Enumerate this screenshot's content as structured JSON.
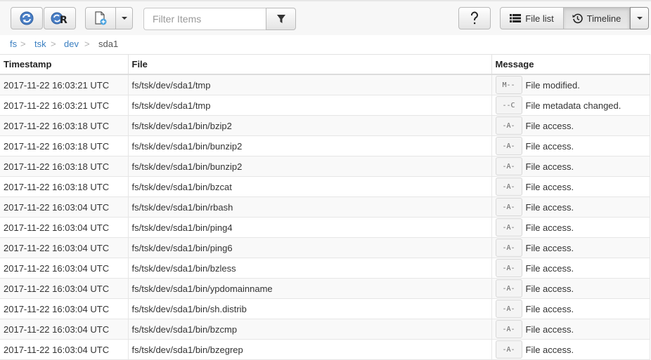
{
  "toolbar": {
    "refresh_icon": "refresh-icon",
    "recursive_refresh_icon": "recursive-refresh-icon",
    "new_file_icon": "new-file-icon",
    "filter_placeholder": "Filter Items",
    "filter_value": "",
    "filter_icon": "funnel-icon",
    "help_icon": "question-mark-icon",
    "file_list_label": "File list",
    "timeline_label": "Timeline"
  },
  "breadcrumb": {
    "items": [
      "fs",
      "tsk",
      "dev"
    ],
    "current": "sda1",
    "separator": ">"
  },
  "table": {
    "headers": {
      "timestamp": "Timestamp",
      "file": "File",
      "message": "Message"
    },
    "rows": [
      {
        "timestamp": "2017-11-22 16:03:21 UTC",
        "file": "fs/tsk/dev/sda1/tmp",
        "flag": "M--",
        "message": "File modified."
      },
      {
        "timestamp": "2017-11-22 16:03:21 UTC",
        "file": "fs/tsk/dev/sda1/tmp",
        "flag": "--C",
        "message": "File metadata changed."
      },
      {
        "timestamp": "2017-11-22 16:03:18 UTC",
        "file": "fs/tsk/dev/sda1/bin/bzip2",
        "flag": "-A-",
        "message": "File access."
      },
      {
        "timestamp": "2017-11-22 16:03:18 UTC",
        "file": "fs/tsk/dev/sda1/bin/bunzip2",
        "flag": "-A-",
        "message": "File access."
      },
      {
        "timestamp": "2017-11-22 16:03:18 UTC",
        "file": "fs/tsk/dev/sda1/bin/bunzip2",
        "flag": "-A-",
        "message": "File access."
      },
      {
        "timestamp": "2017-11-22 16:03:18 UTC",
        "file": "fs/tsk/dev/sda1/bin/bzcat",
        "flag": "-A-",
        "message": "File access."
      },
      {
        "timestamp": "2017-11-22 16:03:04 UTC",
        "file": "fs/tsk/dev/sda1/bin/rbash",
        "flag": "-A-",
        "message": "File access."
      },
      {
        "timestamp": "2017-11-22 16:03:04 UTC",
        "file": "fs/tsk/dev/sda1/bin/ping4",
        "flag": "-A-",
        "message": "File access."
      },
      {
        "timestamp": "2017-11-22 16:03:04 UTC",
        "file": "fs/tsk/dev/sda1/bin/ping6",
        "flag": "-A-",
        "message": "File access."
      },
      {
        "timestamp": "2017-11-22 16:03:04 UTC",
        "file": "fs/tsk/dev/sda1/bin/bzless",
        "flag": "-A-",
        "message": "File access."
      },
      {
        "timestamp": "2017-11-22 16:03:04 UTC",
        "file": "fs/tsk/dev/sda1/bin/ypdomainname",
        "flag": "-A-",
        "message": "File access."
      },
      {
        "timestamp": "2017-11-22 16:03:04 UTC",
        "file": "fs/tsk/dev/sda1/bin/sh.distrib",
        "flag": "-A-",
        "message": "File access."
      },
      {
        "timestamp": "2017-11-22 16:03:04 UTC",
        "file": "fs/tsk/dev/sda1/bin/bzcmp",
        "flag": "-A-",
        "message": "File access."
      },
      {
        "timestamp": "2017-11-22 16:03:04 UTC",
        "file": "fs/tsk/dev/sda1/bin/bzegrep",
        "flag": "-A-",
        "message": "File access."
      }
    ]
  },
  "colors": {
    "link": "#3a7fc1",
    "toolbar_bg": "#f7f7f7",
    "refresh_blue": "#4a7fc6"
  }
}
